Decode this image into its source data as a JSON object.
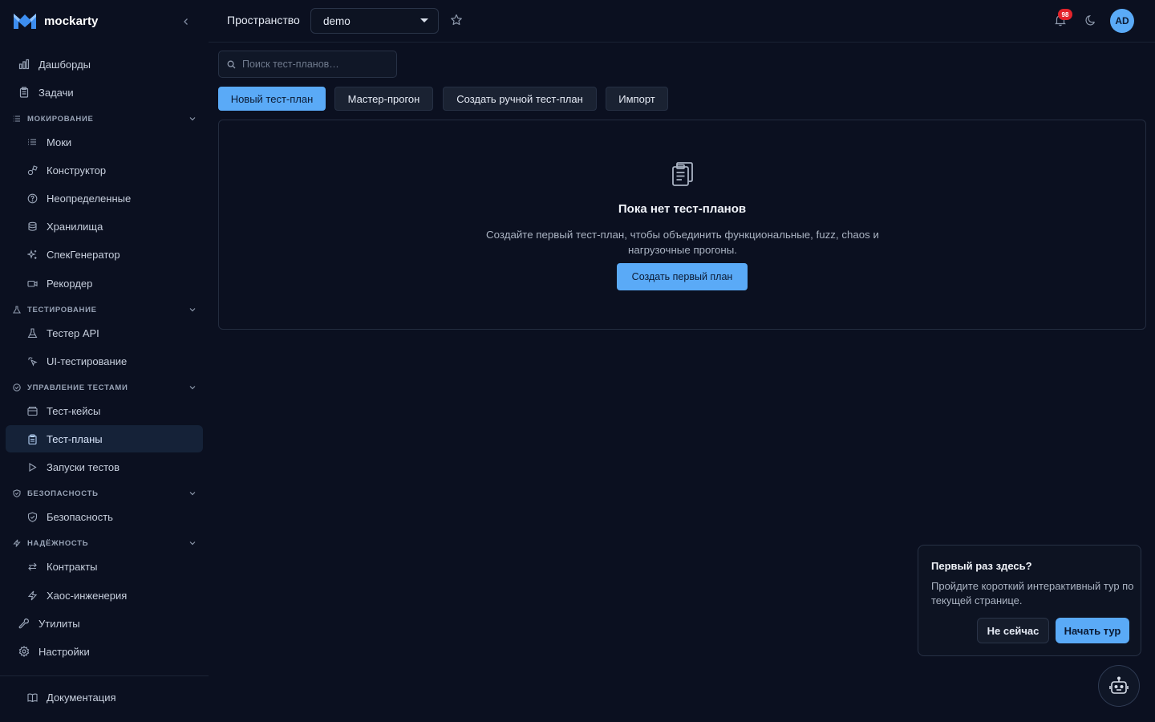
{
  "app": {
    "brand_name": "mockarty",
    "accent_color": "#5aaaf7",
    "background_color": "#0b1020"
  },
  "sidebar": {
    "top_items": [
      {
        "label": "Дашборды",
        "icon": "bar-chart-icon"
      },
      {
        "label": "Задачи",
        "icon": "clipboard-icon"
      }
    ],
    "sections": {
      "mocking": {
        "title": "МОКИРОВАНИЕ",
        "icon": "list-icon",
        "items": [
          {
            "label": "Моки",
            "icon": "list-icon"
          },
          {
            "label": "Конструктор",
            "icon": "shapes-icon"
          },
          {
            "label": "Неопределенные",
            "icon": "question-circle-icon"
          },
          {
            "label": "Хранилища",
            "icon": "database-icon"
          },
          {
            "label": "СпекГенератор",
            "icon": "sparkles-icon"
          },
          {
            "label": "Рекордер",
            "icon": "video-icon"
          }
        ]
      },
      "testing": {
        "title": "ТЕСТИРОВАНИЕ",
        "icon": "flask-icon",
        "items": [
          {
            "label": "Тестер API",
            "icon": "flask-icon"
          },
          {
            "label": "UI-тестирование",
            "icon": "click-icon"
          }
        ]
      },
      "test_management": {
        "title": "УПРАВЛЕНИЕ ТЕСТАМИ",
        "icon": "check-circle-icon",
        "items": [
          {
            "label": "Тест-кейсы",
            "icon": "folder-icon"
          },
          {
            "label": "Тест-планы",
            "icon": "clipboard-icon",
            "active": true
          },
          {
            "label": "Запуски тестов",
            "icon": "play-icon"
          }
        ]
      },
      "security": {
        "title": "БЕЗОПАСНОСТЬ",
        "icon": "shield-icon",
        "items": [
          {
            "label": "Безопасность",
            "icon": "shield-icon"
          }
        ]
      },
      "reliability": {
        "title": "НАДЁЖНОСТЬ",
        "icon": "zap-icon",
        "items": [
          {
            "label": "Контракты",
            "icon": "arrows-icon"
          },
          {
            "label": "Хаос-инженерия",
            "icon": "zap-icon"
          }
        ]
      }
    },
    "bottom_items": [
      {
        "label": "Утилиты",
        "icon": "wrench-icon"
      },
      {
        "label": "Настройки",
        "icon": "gear-icon"
      }
    ],
    "docs_label": "Документация"
  },
  "header": {
    "workspace_label": "Пространство",
    "workspace_value": "demo",
    "notifications_count": "98",
    "avatar_initials": "AD"
  },
  "main": {
    "search_placeholder": "Поиск тест-планов…",
    "actions": {
      "new_plan": "Новый тест-план",
      "wizard_run": "Мастер-прогон",
      "manual_plan": "Создать ручной тест-план",
      "import": "Импорт"
    },
    "empty_state": {
      "title": "Пока нет тест-планов",
      "description": "Создайте первый тест-план, чтобы объединить функциональные, fuzz, chaos и нагрузочные прогоны.",
      "cta": "Создать первый план"
    }
  },
  "tour": {
    "title": "Первый раз здесь?",
    "text": "Пройдите короткий интерактивный тур по текущей странице.",
    "later_label": "Не сейчас",
    "start_label": "Начать тур"
  }
}
